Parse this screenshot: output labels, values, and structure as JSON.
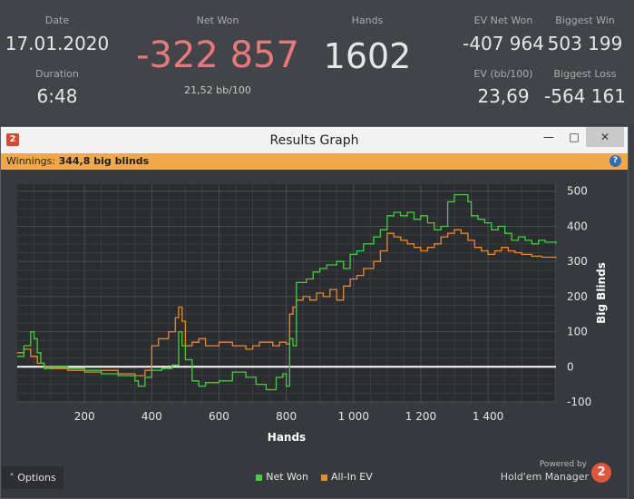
{
  "stats": {
    "date_label": "Date",
    "date_value": "17.01.2020",
    "duration_label": "Duration",
    "duration_value": "6:48",
    "netwon_label": "Net Won",
    "netwon_value": "-322 857",
    "netwon_sub": "21,52 bb/100",
    "hands_label": "Hands",
    "hands_value": "1602",
    "ev_netwon_label": "EV Net Won",
    "ev_netwon_value": "-407 964",
    "ev_bb_label": "EV (bb/100)",
    "ev_bb_value": "23,69",
    "biggest_win_label": "Biggest Win",
    "biggest_win_value": "503 199",
    "biggest_loss_label": "Biggest Loss",
    "biggest_loss_value": "-564 161"
  },
  "window": {
    "title": "Results Graph",
    "logo": "2",
    "minimize_icon": "minimize-icon",
    "maximize_icon": "maximize-icon",
    "close_icon": "close-icon",
    "winnings_label": "Winnings:",
    "winnings_value": "344,8 big blinds",
    "help_icon": "?"
  },
  "footer": {
    "options_label": "Options",
    "powered_by": "Powered by",
    "brand": "Hold'em Manager",
    "brand_logo": "2"
  },
  "colors": {
    "net_won": "#3fd13a",
    "all_in_ev": "#e88a2c",
    "netwon_text": "#e8787a",
    "accent_bar": "#f0a946"
  },
  "chart_data": {
    "type": "line",
    "xlabel": "Hands",
    "ylabel": "Big Blinds",
    "xlim": [
      0,
      1602
    ],
    "ylim": [
      -100,
      520
    ],
    "x_ticks": [
      200,
      400,
      600,
      800,
      1000,
      1200,
      1400
    ],
    "x_tick_labels": [
      "200",
      "400",
      "600",
      "800",
      "1 000",
      "1 200",
      "1 400"
    ],
    "y_ticks": [
      -100,
      0,
      100,
      200,
      300,
      400,
      500
    ],
    "grid": true,
    "legend": "bottom-center",
    "series": [
      {
        "name": "Net Won",
        "color": "#3fd13a",
        "points": [
          [
            0,
            30
          ],
          [
            20,
            60
          ],
          [
            40,
            100
          ],
          [
            50,
            80
          ],
          [
            60,
            40
          ],
          [
            70,
            10
          ],
          [
            80,
            -5
          ],
          [
            100,
            0
          ],
          [
            150,
            -5
          ],
          [
            200,
            -10
          ],
          [
            250,
            -20
          ],
          [
            300,
            -25
          ],
          [
            350,
            -40
          ],
          [
            360,
            -55
          ],
          [
            380,
            -30
          ],
          [
            400,
            -10
          ],
          [
            430,
            -5
          ],
          [
            460,
            5
          ],
          [
            480,
            100
          ],
          [
            490,
            60
          ],
          [
            500,
            20
          ],
          [
            520,
            -40
          ],
          [
            540,
            -55
          ],
          [
            560,
            -45
          ],
          [
            600,
            -40
          ],
          [
            640,
            -15
          ],
          [
            680,
            -30
          ],
          [
            710,
            -50
          ],
          [
            740,
            -65
          ],
          [
            770,
            -30
          ],
          [
            790,
            -20
          ],
          [
            800,
            -55
          ],
          [
            810,
            80
          ],
          [
            820,
            60
          ],
          [
            830,
            240
          ],
          [
            860,
            250
          ],
          [
            880,
            270
          ],
          [
            900,
            280
          ],
          [
            920,
            290
          ],
          [
            950,
            300
          ],
          [
            970,
            280
          ],
          [
            990,
            320
          ],
          [
            1010,
            330
          ],
          [
            1030,
            350
          ],
          [
            1060,
            370
          ],
          [
            1080,
            390
          ],
          [
            1100,
            430
          ],
          [
            1120,
            440
          ],
          [
            1140,
            430
          ],
          [
            1160,
            440
          ],
          [
            1180,
            420
          ],
          [
            1200,
            430
          ],
          [
            1220,
            410
          ],
          [
            1240,
            390
          ],
          [
            1260,
            400
          ],
          [
            1280,
            470
          ],
          [
            1300,
            490
          ],
          [
            1320,
            490
          ],
          [
            1340,
            470
          ],
          [
            1350,
            430
          ],
          [
            1370,
            420
          ],
          [
            1390,
            410
          ],
          [
            1410,
            390
          ],
          [
            1430,
            400
          ],
          [
            1450,
            380
          ],
          [
            1470,
            360
          ],
          [
            1490,
            370
          ],
          [
            1510,
            360
          ],
          [
            1530,
            350
          ],
          [
            1550,
            360
          ],
          [
            1570,
            355
          ],
          [
            1602,
            350
          ]
        ]
      },
      {
        "name": "All-In EV",
        "color": "#e88a2c",
        "points": [
          [
            0,
            40
          ],
          [
            20,
            50
          ],
          [
            40,
            30
          ],
          [
            60,
            10
          ],
          [
            80,
            0
          ],
          [
            100,
            -5
          ],
          [
            150,
            -10
          ],
          [
            200,
            -15
          ],
          [
            250,
            -10
          ],
          [
            300,
            -20
          ],
          [
            350,
            -25
          ],
          [
            380,
            -10
          ],
          [
            400,
            60
          ],
          [
            420,
            80
          ],
          [
            450,
            100
          ],
          [
            470,
            140
          ],
          [
            480,
            170
          ],
          [
            490,
            130
          ],
          [
            500,
            60
          ],
          [
            520,
            70
          ],
          [
            540,
            80
          ],
          [
            560,
            60
          ],
          [
            600,
            70
          ],
          [
            640,
            60
          ],
          [
            680,
            50
          ],
          [
            700,
            60
          ],
          [
            720,
            70
          ],
          [
            760,
            60
          ],
          [
            780,
            70
          ],
          [
            800,
            65
          ],
          [
            810,
            150
          ],
          [
            820,
            170
          ],
          [
            830,
            190
          ],
          [
            850,
            200
          ],
          [
            870,
            190
          ],
          [
            890,
            210
          ],
          [
            910,
            200
          ],
          [
            930,
            220
          ],
          [
            950,
            190
          ],
          [
            970,
            230
          ],
          [
            990,
            250
          ],
          [
            1010,
            260
          ],
          [
            1030,
            280
          ],
          [
            1060,
            300
          ],
          [
            1080,
            330
          ],
          [
            1100,
            380
          ],
          [
            1120,
            370
          ],
          [
            1140,
            360
          ],
          [
            1160,
            350
          ],
          [
            1180,
            340
          ],
          [
            1200,
            330
          ],
          [
            1220,
            340
          ],
          [
            1240,
            350
          ],
          [
            1260,
            370
          ],
          [
            1280,
            380
          ],
          [
            1300,
            390
          ],
          [
            1320,
            380
          ],
          [
            1340,
            360
          ],
          [
            1360,
            340
          ],
          [
            1380,
            330
          ],
          [
            1400,
            320
          ],
          [
            1420,
            330
          ],
          [
            1440,
            340
          ],
          [
            1460,
            330
          ],
          [
            1480,
            325
          ],
          [
            1500,
            320
          ],
          [
            1530,
            315
          ],
          [
            1560,
            312
          ],
          [
            1602,
            310
          ]
        ]
      }
    ]
  }
}
